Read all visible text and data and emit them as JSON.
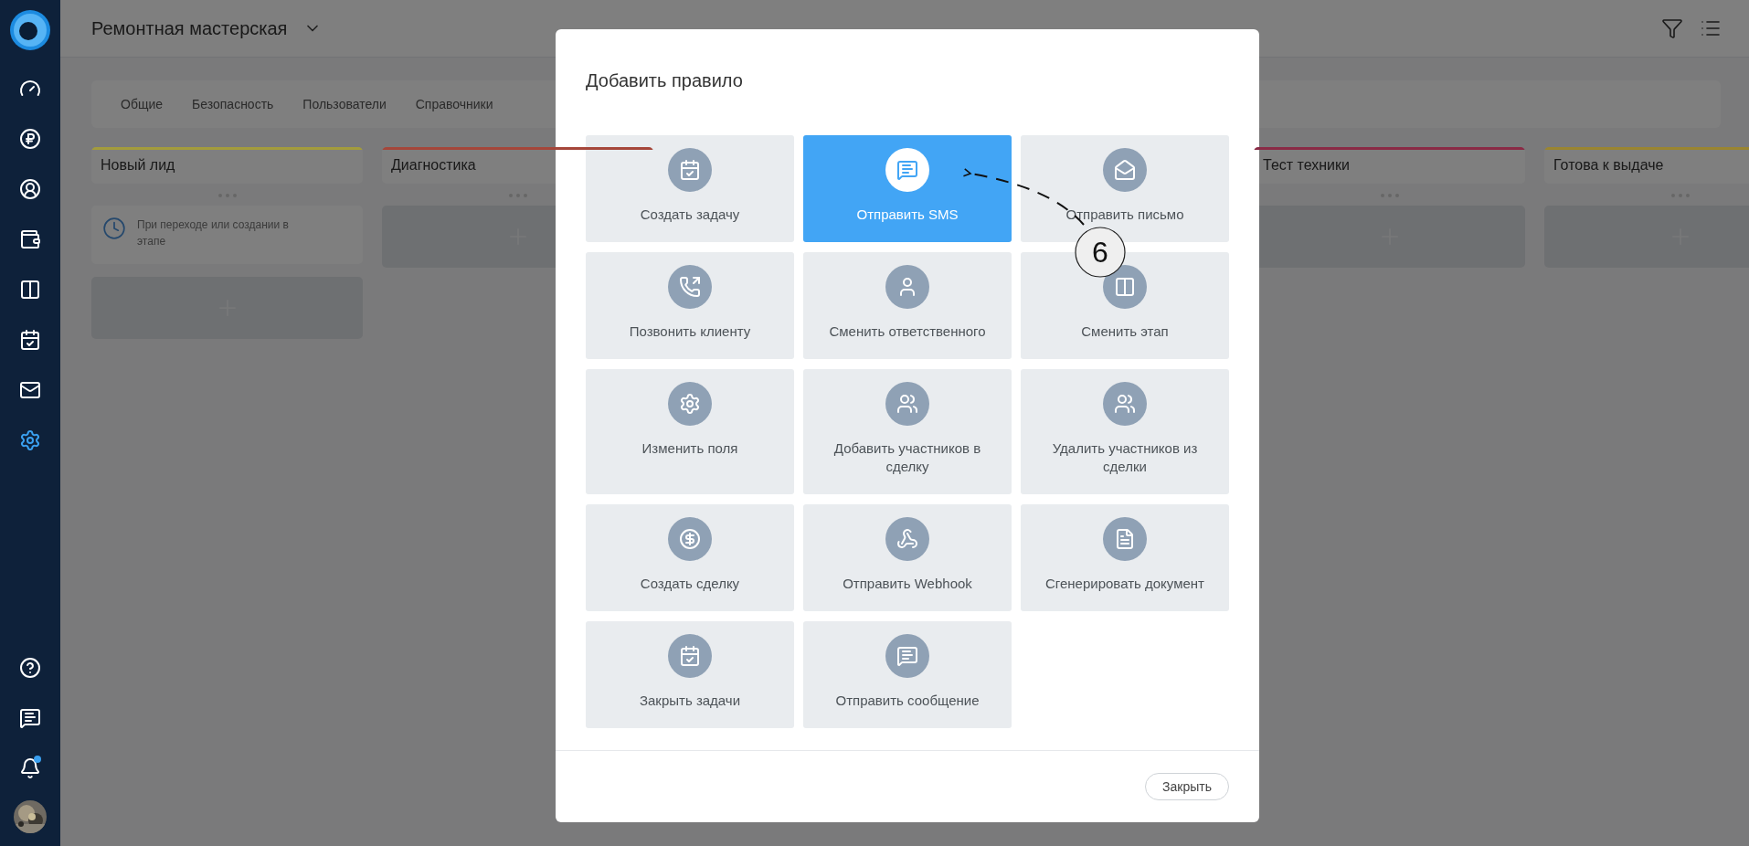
{
  "sidebar": {
    "items": [
      {
        "kind": "dashboard",
        "selected": false
      },
      {
        "kind": "finance",
        "selected": false
      },
      {
        "kind": "contacts",
        "selected": false
      },
      {
        "kind": "deals",
        "selected": false
      },
      {
        "kind": "board",
        "selected": false
      },
      {
        "kind": "tasks",
        "selected": false
      },
      {
        "kind": "mail",
        "selected": false
      },
      {
        "kind": "settings",
        "selected": true
      }
    ],
    "bottom_items": [
      {
        "kind": "help"
      },
      {
        "kind": "chat"
      },
      {
        "kind": "notifications",
        "unread": true
      }
    ]
  },
  "header": {
    "title": "Ремонтная мастерская"
  },
  "settings_tabs": [
    "Общие",
    "Безопасность",
    "Пользователи",
    "Справочники"
  ],
  "board": {
    "left_columns": [
      {
        "name": "Новый лид",
        "color": "#a39c3c",
        "cards": [
          {
            "text": "При переходе или создании в этапе"
          }
        ]
      },
      {
        "name": "Диагностика",
        "color": "#a5463a"
      }
    ],
    "right_columns": [
      {
        "name": "Тест техники",
        "color": "#8a2a45"
      },
      {
        "name": "Готова к выдаче",
        "color": "#9a8530"
      }
    ]
  },
  "dialog": {
    "title": "Добавить правило",
    "actions": [
      {
        "kind": "create_task",
        "label": "Создать задачу",
        "selected": false
      },
      {
        "kind": "send_sms",
        "label": "Отправить SMS",
        "selected": true
      },
      {
        "kind": "send_email",
        "label": "Отправить письмо",
        "selected": false
      },
      {
        "kind": "call",
        "label": "Позвонить клиенту",
        "selected": false
      },
      {
        "kind": "change_owner",
        "label": "Сменить ответственного",
        "selected": false
      },
      {
        "kind": "change_stage",
        "label": "Сменить этап",
        "selected": false
      },
      {
        "kind": "edit_fields",
        "label": "Изменить поля",
        "selected": false
      },
      {
        "kind": "add_members",
        "label": "Добавить участников в сделку",
        "selected": false
      },
      {
        "kind": "remove_members",
        "label": "Удалить участников из сделки",
        "selected": false
      },
      {
        "kind": "create_deal",
        "label": "Создать сделку",
        "selected": false
      },
      {
        "kind": "webhook",
        "label": "Отправить Webhook",
        "selected": false
      },
      {
        "kind": "document",
        "label": "Сгенерировать документ",
        "selected": false
      },
      {
        "kind": "close_tasks",
        "label": "Закрыть задачи",
        "selected": false
      },
      {
        "kind": "send_message",
        "label": "Отправить сообщение",
        "selected": false
      }
    ],
    "close_button": "Закрыть"
  },
  "annotation": {
    "number": "6"
  }
}
